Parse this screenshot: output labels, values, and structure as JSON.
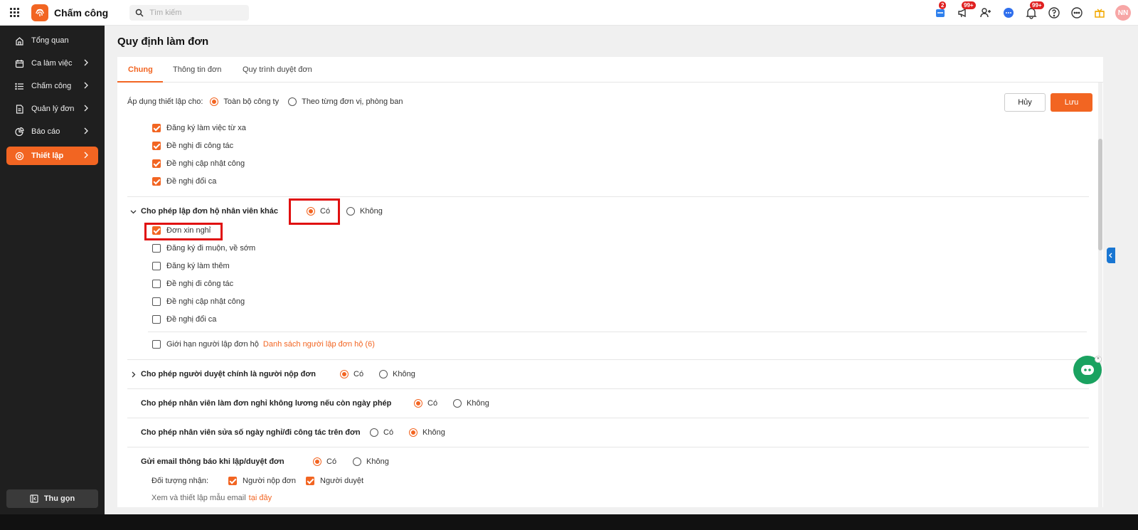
{
  "app": {
    "name": "Chấm công",
    "search_placeholder": "Tìm kiếm"
  },
  "topbar": {
    "badges": {
      "inbox": "2",
      "megaphone": "99+",
      "bell": "99+"
    },
    "avatar_initials": "NN"
  },
  "sidebar": {
    "items": [
      {
        "label": "Tổng quan",
        "icon": "home-icon"
      },
      {
        "label": "Ca làm việc",
        "icon": "calendar-icon"
      },
      {
        "label": "Chấm công",
        "icon": "list-icon"
      },
      {
        "label": "Quản lý đơn",
        "icon": "document-icon"
      },
      {
        "label": "Báo cáo",
        "icon": "pie-chart-icon"
      },
      {
        "label": "Thiết lập",
        "icon": "gear-icon"
      }
    ],
    "collapse_label": "Thu gọn"
  },
  "page": {
    "title": "Quy định làm đơn",
    "tabs": [
      "Chung",
      "Thông tin đơn",
      "Quy trình duyệt đơn"
    ],
    "active_tab": "Chung"
  },
  "actions": {
    "cancel": "Hủy",
    "save": "Lưu"
  },
  "apply": {
    "label": "Áp dụng thiết lập cho:",
    "options": [
      "Toàn bộ công ty",
      "Theo từng đơn vị, phòng ban"
    ],
    "selected": "Toàn bộ công ty"
  },
  "top_checklist": [
    {
      "label": "Đăng ký làm việc từ xa",
      "checked": true
    },
    {
      "label": "Đề nghị đi công tác",
      "checked": true
    },
    {
      "label": "Đề nghị cập nhật công",
      "checked": true
    },
    {
      "label": "Đề nghị đổi ca",
      "checked": true
    }
  ],
  "on_behalf": {
    "label": "Cho phép lập đơn hộ nhân viên khác",
    "yes": "Có",
    "no": "Không",
    "selected": "Có",
    "items": [
      {
        "label": "Đơn xin nghỉ",
        "checked": true
      },
      {
        "label": "Đăng ký đi muộn, về sớm",
        "checked": false
      },
      {
        "label": "Đăng ký làm thêm",
        "checked": false
      },
      {
        "label": "Đề nghị đi công tác",
        "checked": false
      },
      {
        "label": "Đề nghị cập nhật công",
        "checked": false
      },
      {
        "label": "Đề nghị đổi ca",
        "checked": false
      }
    ],
    "limit_label": "Giới hạn người lập đơn hộ",
    "limit_link": "Danh sách người lập đơn hộ (6)"
  },
  "settings": [
    {
      "label": "Cho phép người duyệt chính là người nộp đơn",
      "yes": "Có",
      "no": "Không",
      "selected": "Có"
    },
    {
      "label": "Cho phép nhân viên làm đơn nghỉ không lương nếu còn ngày phép",
      "yes": "Có",
      "no": "Không",
      "selected": "Có"
    },
    {
      "label": "Cho phép nhân viên sửa số ngày nghỉ/đi công tác trên đơn",
      "yes": "Có",
      "no": "Không",
      "selected": "Không"
    },
    {
      "label": "Gửi email thông báo khi lập/duyệt đơn",
      "yes": "Có",
      "no": "Không",
      "selected": "Có"
    }
  ],
  "email": {
    "recipients_label": "Đối tượng nhận:",
    "recipients": [
      {
        "label": "Người nộp đơn",
        "checked": true
      },
      {
        "label": "Người duyệt",
        "checked": true
      }
    ],
    "template_text": "Xem và thiết lập mẫu email",
    "template_link": "tại đây"
  },
  "colors": {
    "accent": "#f26522",
    "sidebar_bg": "#1f1f1f",
    "highlight": "#e01010"
  }
}
